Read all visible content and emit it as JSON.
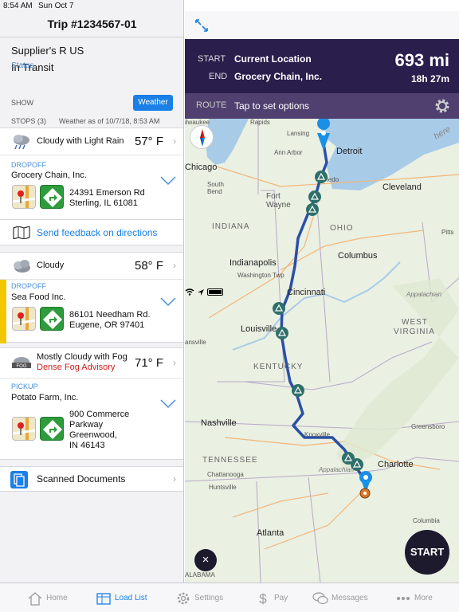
{
  "status_bar": {
    "time": "8:54 AM",
    "date": "Sun Oct 7"
  },
  "trip": {
    "title": "Trip #1234567-01",
    "supplier": "Supplier's R US",
    "status_label": "Status",
    "status_value": "In Transit",
    "show_label": "SHOW",
    "weather_button": "Weather",
    "stops_label": "STOPS (3)",
    "weather_asof": "Weather as of 10/7/18, 8:53 AM"
  },
  "stops": [
    {
      "weather": "Cloudy with Light Rain",
      "temp": "57° F",
      "type": "DROPOFF",
      "name": "Grocery Chain, Inc.",
      "address": [
        "24391 Emerson Rd",
        "Sterling, IL 61081"
      ]
    },
    {
      "weather": "Cloudy",
      "temp": "58° F",
      "type": "DROPOFF",
      "name": "Sea Food Inc.",
      "address": [
        "86101 Needham Rd.",
        "Eugene, OR 97401"
      ]
    },
    {
      "weather": "Mostly Cloudy with Fog",
      "advisory": "Dense Fog Advisory",
      "temp": "71° F",
      "type": "PICKUP",
      "name": "Potato Farm, Inc.",
      "address": [
        "900 Commerce",
        "Parkway",
        "Greenwood,",
        "IN 46143"
      ]
    }
  ],
  "feedback_link": "Send feedback on directions",
  "scanned_documents": "Scanned Documents",
  "route": {
    "start_label": "START",
    "start_value": "Current Location",
    "end_label": "END",
    "end_value": "Grocery Chain, Inc.",
    "distance": "693 mi",
    "duration": "18h 27m",
    "route_label": "ROUTE",
    "route_value": "Tap to set options"
  },
  "map": {
    "labels": {
      "milwaukee": "ilwaukee",
      "rapids": "Rapids",
      "lansing": "Lansing",
      "detroit": "Detroit",
      "annarbor": "Ann Arbor",
      "chicago": "Chicago",
      "toledo": "ledo",
      "cleveland": "Cleveland",
      "southbend": "South Bend",
      "fortwayne": "Fort Wayne",
      "indiana": "INDIANA",
      "ohio": "OHIO",
      "pitts": "Pitts",
      "columbus": "Columbus",
      "indianapolis": "Indianapolis",
      "washingtontwp": "Washington Twp",
      "cincinnati": "Cincinnati",
      "appalachian1": "Appalachian",
      "louisville": "Louisville",
      "westvirginia1": "WEST",
      "westvirginia2": "VIRGINIA",
      "ansville": "ansville",
      "kentucky": "KENTUCKY",
      "nashville": "Nashville",
      "knoxville": "Knoxville",
      "greensboro": "Greensboro",
      "tennessee": "TENNESSEE",
      "charlotte": "Charlotte",
      "chattanooga": "Chattanooga",
      "appalachian2": "Appalachian",
      "huntsville": "Huntsville",
      "atlanta": "Atlanta",
      "columbia": "Columbia",
      "alabama": "ALABAMA",
      "here": "here"
    },
    "start_button": "START",
    "close_button": "×"
  },
  "tabs": [
    {
      "label": "Home",
      "icon": "home-icon"
    },
    {
      "label": "Load List",
      "icon": "load-list-icon"
    },
    {
      "label": "Settings",
      "icon": "gear-icon"
    },
    {
      "label": "Pay",
      "icon": "dollar-icon"
    },
    {
      "label": "Messages",
      "icon": "messages-icon"
    },
    {
      "label": "More",
      "icon": "more-icon"
    }
  ],
  "colors": {
    "accent": "#1a7fe6",
    "route": "#2a4fa6",
    "header": "#2a1e4d",
    "highlight": "#f2c700",
    "advisory": "#d0201c"
  }
}
